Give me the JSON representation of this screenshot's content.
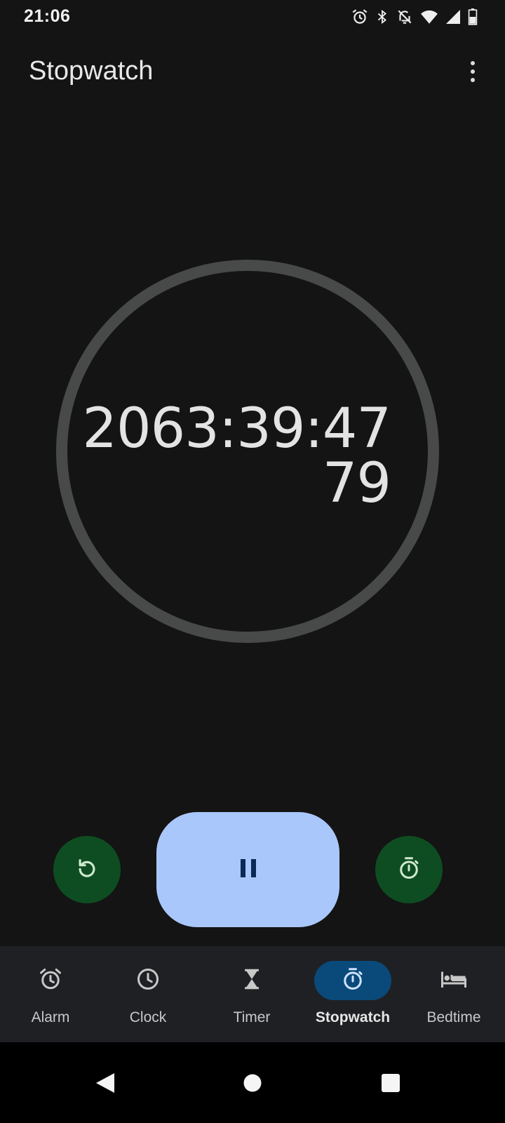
{
  "status_bar": {
    "time": "21:06",
    "icons": [
      "alarm-icon",
      "bluetooth-icon",
      "notifications-off-icon",
      "wifi-icon",
      "cellular-signal-icon",
      "battery-icon"
    ]
  },
  "app_bar": {
    "title": "Stopwatch",
    "menu_icon": "more-vert-icon"
  },
  "stopwatch": {
    "elapsed": "2063:39:47",
    "hundredths": "79"
  },
  "controls": {
    "reset_icon": "reset-icon",
    "pause_icon": "pause-icon",
    "lap_icon": "lap-icon"
  },
  "bottom_nav": {
    "items": [
      {
        "label": "Alarm",
        "icon": "alarm-icon",
        "active": false
      },
      {
        "label": "Clock",
        "icon": "clock-icon",
        "active": false
      },
      {
        "label": "Timer",
        "icon": "hourglass-icon",
        "active": false
      },
      {
        "label": "Stopwatch",
        "icon": "stopwatch-icon",
        "active": true
      },
      {
        "label": "Bedtime",
        "icon": "bed-icon",
        "active": false
      }
    ]
  },
  "system_nav": {
    "buttons": [
      "back-icon",
      "home-icon",
      "recents-icon"
    ]
  },
  "colors": {
    "background": "#141414",
    "dial_ring": "#484a49",
    "primary_button": "#a9c7fa",
    "secondary_button": "#0e4d22",
    "nav_bar": "#1f2023",
    "nav_active_pill": "#0a4a7a"
  }
}
